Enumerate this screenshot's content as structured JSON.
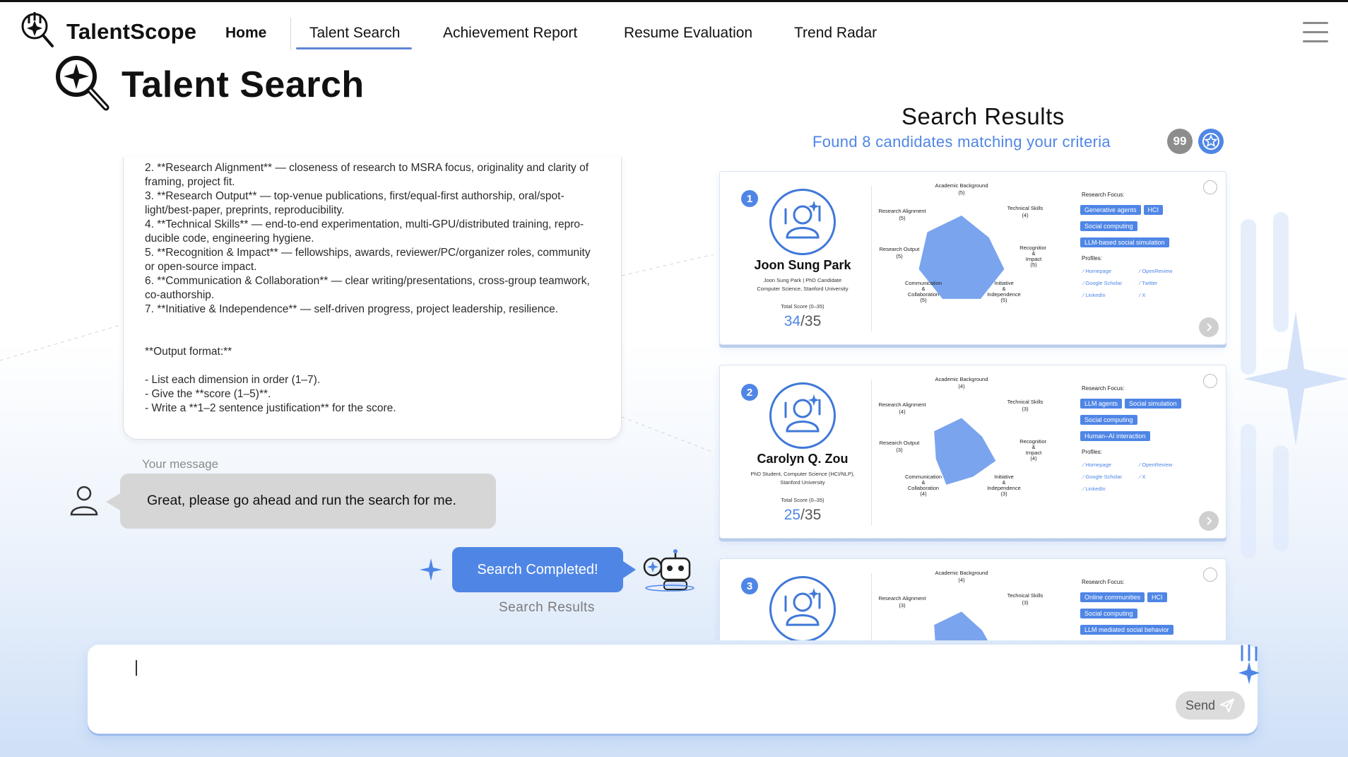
{
  "app": {
    "brand": "TalentScope",
    "nav": [
      {
        "label": "Home"
      },
      {
        "label": "Talent Search"
      },
      {
        "label": "Achievement Report"
      },
      {
        "label": "Resume Evaluation"
      },
      {
        "label": "Trend Radar"
      }
    ]
  },
  "page": {
    "title": "Talent Search"
  },
  "chat": {
    "prompt_lines": [
      "2. **Research Alignment** — closeness of research to MSRA focus, originality and clarity of",
      "framing, project fit.",
      "3. **Research Output** — top-venue publications, first/equal-first authorship, oral/spot-",
      "light/best-paper, preprints, reproducibility.",
      "4. **Technical Skills** — end-to-end experimentation, multi-GPU/distributed training, repro-",
      "ducible code, engineering hygiene.",
      "5. **Recognition & Impact** — fellowships, awards, reviewer/PC/organizer roles, community",
      "or open-source impact.",
      "6. **Communication & Collaboration** — clear writing/presentations, cross-group teamwork,",
      "co-authorship.",
      "7. **Initiative & Independence** — self-driven progress, project leadership, resilience.",
      "",
      "",
      "**Output format:**",
      "",
      "- List each dimension in order (1–7).",
      "- Give the **score (1–5)**.",
      "- Write a **1–2 sentence justification** for the score."
    ],
    "your_message_label": "Your message",
    "user_message": "Great, please go ahead and run the search for me.",
    "status_button": "Search Completed!",
    "results_link": "Search Results"
  },
  "results": {
    "title": "Search Results",
    "subtitle": "Found 8 candidates matching your criteria",
    "badge_count": "99",
    "candidates": [
      {
        "rank": "1",
        "name": "Joon Sung Park",
        "affiliation_line1": "Joon Sung Park | PhD Candidate",
        "affiliation_line2": "Computer Science, Stanford University",
        "affiliation_line3": "",
        "score_label": "Total Score (0–35)",
        "score": "34",
        "score_max": "/35",
        "radar": {
          "academic": "Academic Background",
          "academic_score": "(5)",
          "technical": "Technical Skills",
          "technical_score": "(4)",
          "recognition_1": "Recognition",
          "recognition_2": "&",
          "recognition_3": "Impact",
          "recognition_score": "(5)",
          "initiative_1": "Initiative",
          "initiative_2": "&",
          "initiative_3": "Independence",
          "initiative_score": "(5)",
          "communication_1": "Communication",
          "communication_2": "&",
          "communication_3": "Collaboration",
          "communication_score": "(5)",
          "output": "Research Output",
          "output_score": "(5)",
          "alignment": "Research Alignment",
          "alignment_score": "(5)",
          "values": [
            5,
            4,
            5,
            5,
            5,
            5,
            5
          ]
        },
        "focus_label": "Research Focus:",
        "tags": [
          "Generative agents",
          "HCI",
          "Social computing",
          "LLM-based social simulation"
        ],
        "profiles_label": "Profiles:",
        "profiles": [
          "Homepage",
          "OpenReview",
          "Google Scholar",
          "Twitter",
          "LinkedIn",
          "X"
        ]
      },
      {
        "rank": "2",
        "name": "Carolyn Q. Zou",
        "affiliation_line1": "PhD Student, Computer Science (HCI/NLP),",
        "affiliation_line2": "Stanford University",
        "affiliation_line3": "",
        "score_label": "Total Score (0–35)",
        "score": "25",
        "score_max": "/35",
        "radar": {
          "academic": "Academic Background",
          "academic_score": "(4)",
          "technical": "Technical Skills",
          "technical_score": "(3)",
          "recognition_1": "Recognition",
          "recognition_2": "&",
          "recognition_3": "Impact",
          "recognition_score": "(4)",
          "initiative_1": "Initiative",
          "initiative_2": "&",
          "initiative_3": "Independence",
          "initiative_score": "(3)",
          "communication_1": "Communication",
          "communication_2": "&",
          "communication_3": "Collaboration",
          "communication_score": "(4)",
          "output": "Research Output",
          "output_score": "(3)",
          "alignment": "Research Alignment",
          "alignment_score": "(4)",
          "values": [
            4,
            3,
            4,
            3,
            4,
            3,
            4
          ]
        },
        "focus_label": "Research Focus:",
        "tags": [
          "LLM agents",
          "Social simulation",
          "Social computing",
          "Human–AI interaction"
        ],
        "profiles_label": "Profiles:",
        "profiles": [
          "Homepage",
          "OpenReview",
          "Google Scholar",
          "X",
          "LinkedIn"
        ]
      },
      {
        "rank": "3",
        "name": "",
        "affiliation_line1": "",
        "affiliation_line2": "",
        "affiliation_line3": "",
        "score_label": "",
        "score": "",
        "score_max": "",
        "radar": {
          "academic": "Academic Background",
          "academic_score": "(4)",
          "technical": "Technical Skills",
          "technical_score": "(3)",
          "recognition_1": "",
          "recognition_2": "",
          "recognition_3": "",
          "recognition_score": "",
          "initiative_1": "",
          "initiative_2": "",
          "initiative_3": "",
          "initiative_score": "",
          "communication_1": "",
          "communication_2": "",
          "communication_3": "",
          "communication_score": "",
          "output": "",
          "output_score": "",
          "alignment": "Research Alignment",
          "alignment_score": "(3)",
          "values": [
            4,
            3,
            4,
            3,
            4,
            3,
            4
          ]
        },
        "focus_label": "Research Focus:",
        "tags": [
          "Online communities",
          "HCI",
          "Social computing",
          "LLM mediated social behavior"
        ],
        "profiles_label": "",
        "profiles": []
      }
    ]
  },
  "input": {
    "value": "",
    "placeholder": "",
    "send_label": "Send"
  },
  "colors": {
    "accent": "#4f86e6",
    "radar_fill": "#7aa4ee",
    "user_bubble": "#d6d6d6"
  }
}
